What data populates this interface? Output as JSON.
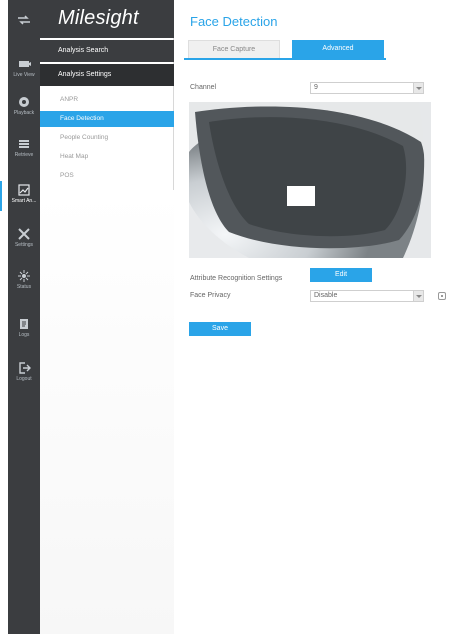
{
  "brand": {
    "name": "Milesight"
  },
  "rail": [
    {
      "label": "",
      "icon": "shuffle-icon"
    },
    {
      "label": "Live View",
      "icon": "live-view-icon"
    },
    {
      "label": "Playback",
      "icon": "playback-icon"
    },
    {
      "label": "Retrieve",
      "icon": "retrieve-icon"
    },
    {
      "label": "Smart An...",
      "icon": "smart-analytics-icon"
    },
    {
      "label": "Settings",
      "icon": "settings-icon"
    },
    {
      "label": "Status",
      "icon": "status-icon"
    },
    {
      "label": "Logs",
      "icon": "logs-icon"
    },
    {
      "label": "Logout",
      "icon": "logout-icon"
    }
  ],
  "menu": {
    "section1": "Analysis Search",
    "section2": "Analysis Settings",
    "items": [
      "ANPR",
      "Face Detection",
      "People Counting",
      "Heat Map",
      "POS"
    ],
    "active_index": 1
  },
  "page": {
    "title": "Face Detection",
    "tabs": [
      "Face Capture",
      "Advanced"
    ],
    "active_tab": "Advanced",
    "channel_label": "Channel",
    "channel_value": "9",
    "attribute_label": "Attribute Recognition Settings",
    "edit_label": "Edit",
    "privacy_label": "Face Privacy",
    "privacy_value": "Disable",
    "save_label": "Save"
  },
  "colors": {
    "accent": "#2aa4e8",
    "rail_bg": "#3b3d40"
  }
}
